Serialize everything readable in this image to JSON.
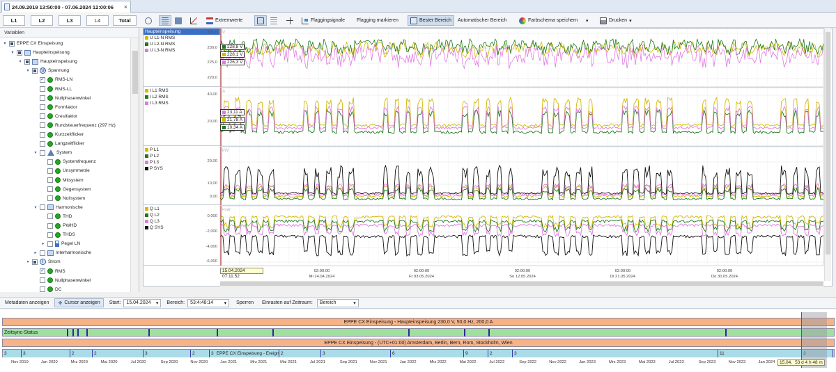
{
  "tab": {
    "title": "24.09.2019 13:50:00 - 07.06.2024 12:00:06"
  },
  "toolbar": {
    "buttons": [
      "L1",
      "L2",
      "L3",
      "L4",
      "Total"
    ],
    "extremwerte": "Extremwerte",
    "flaggingsignale": "Flaggingsignale",
    "flagging_markieren": "Flagging markieren",
    "bester_bereich": "Bester Bereich",
    "automatischer_bereich": "Automatischer Bereich",
    "farbschema": "Farbschema speichern",
    "drucken": "Drucken"
  },
  "tree": {
    "header": "Variablen",
    "items": [
      {
        "label": "EPPE CX Einspeisung",
        "level": 0,
        "arrow": "▾",
        "check": "part",
        "icon": "none"
      },
      {
        "label": "Haupteinspeisung",
        "level": 1,
        "arrow": "▾",
        "check": "part",
        "icon": "device"
      },
      {
        "label": "Haupteinspeisung",
        "level": 2,
        "arrow": "▾",
        "check": "part",
        "icon": "meter"
      },
      {
        "label": "Spannung",
        "level": 3,
        "arrow": "▾",
        "check": "part",
        "icon": "U"
      },
      {
        "label": "RMS-LN",
        "level": 4,
        "arrow": "",
        "check": "checked",
        "icon": "dot"
      },
      {
        "label": "RMS-LL",
        "level": 4,
        "arrow": "",
        "check": "empty",
        "icon": "dot"
      },
      {
        "label": "Nullphasenwinkel",
        "level": 4,
        "arrow": "",
        "check": "empty",
        "icon": "dot"
      },
      {
        "label": "Formfaktor",
        "level": 4,
        "arrow": "",
        "check": "empty",
        "icon": "dot"
      },
      {
        "label": "Crestfaktor",
        "level": 4,
        "arrow": "",
        "check": "empty",
        "icon": "dot"
      },
      {
        "label": "Rundsteuerfrequenz (297 Hz)",
        "level": 4,
        "arrow": "",
        "check": "empty",
        "icon": "dot"
      },
      {
        "label": "Kurzzeitflicker",
        "level": 4,
        "arrow": "",
        "check": "empty",
        "icon": "dot"
      },
      {
        "label": "Langzeitflicker",
        "level": 4,
        "arrow": "",
        "check": "empty",
        "icon": "dot"
      },
      {
        "label": "System",
        "level": 4,
        "arrow": "▾",
        "check": "empty",
        "icon": "triangle"
      },
      {
        "label": "Systemfrequenz",
        "level": 5,
        "arrow": "",
        "check": "empty",
        "icon": "dot"
      },
      {
        "label": "Unsymmetrie",
        "level": 5,
        "arrow": "",
        "check": "empty",
        "icon": "dot"
      },
      {
        "label": "Mitsystem",
        "level": 5,
        "arrow": "",
        "check": "empty",
        "icon": "dot"
      },
      {
        "label": "Gegensystem",
        "level": 5,
        "arrow": "",
        "check": "empty",
        "icon": "dot"
      },
      {
        "label": "Nullsystem",
        "level": 5,
        "arrow": "",
        "check": "empty",
        "icon": "dot"
      },
      {
        "label": "Harmonische",
        "level": 4,
        "arrow": "▾",
        "check": "empty",
        "icon": "chart"
      },
      {
        "label": "THD",
        "level": 5,
        "arrow": "",
        "check": "empty",
        "icon": "dot"
      },
      {
        "label": "PWHD",
        "level": 5,
        "arrow": "",
        "check": "empty",
        "icon": "dot"
      },
      {
        "label": "THDS",
        "level": 5,
        "arrow": "",
        "check": "empty",
        "icon": "dot"
      },
      {
        "label": "Pegel LN",
        "level": 5,
        "arrow": "▸",
        "check": "empty",
        "icon": "bar"
      },
      {
        "label": "Interharmonische",
        "level": 4,
        "arrow": "▸",
        "check": "empty",
        "icon": "chart"
      },
      {
        "label": "Strom",
        "level": 3,
        "arrow": "▾",
        "check": "part",
        "icon": "I"
      },
      {
        "label": "RMS",
        "level": 4,
        "arrow": "",
        "check": "checked",
        "icon": "dot"
      },
      {
        "label": "Nullphasenwinkel",
        "level": 4,
        "arrow": "",
        "check": "empty",
        "icon": "dot"
      },
      {
        "label": "DC",
        "level": 4,
        "arrow": "",
        "check": "empty",
        "icon": "dot"
      }
    ]
  },
  "charts": [
    {
      "legend": [
        {
          "label": "Haupteinspeisung",
          "color": "",
          "selected": true
        },
        {
          "label": "U L1-N RMS",
          "color": "#d4b800"
        },
        {
          "label": "U L2-N RMS",
          "color": "#1a7a1a"
        },
        {
          "label": "U L3-N RMS",
          "color": "#e07ae0"
        }
      ],
      "unit": "V",
      "ticks": [
        "235,0",
        "230,0",
        "225,0",
        "220,0"
      ],
      "values": [
        {
          "text": "228,8 V",
          "color": "#1a7a1a"
        },
        {
          "text": "228,1 V",
          "color": "#d4b800"
        },
        {
          "text": "226,3 V",
          "color": "#e07ae0"
        }
      ]
    },
    {
      "legend": [
        {
          "label": "I L1 RMS",
          "color": "#d4b800"
        },
        {
          "label": "I L2 RMS",
          "color": "#1a7a1a"
        },
        {
          "label": "I L3 RMS",
          "color": "#e07ae0"
        }
      ],
      "unit": "A",
      "ticks": [
        "40,00",
        "20,00"
      ],
      "values": [
        {
          "text": "23,11 A",
          "color": "#e07ae0"
        },
        {
          "text": "21,78 A",
          "color": "#d4b800"
        },
        {
          "text": "10,34 A",
          "color": "#1a7a1a"
        }
      ]
    },
    {
      "legend": [
        {
          "label": "P L1",
          "color": "#d4b800"
        },
        {
          "label": "P L2",
          "color": "#1a7a1a"
        },
        {
          "label": "P L3",
          "color": "#e07ae0"
        },
        {
          "label": "P SYS",
          "color": "#111111"
        }
      ],
      "unit": "kW",
      "ticks": [
        "20,00",
        "10,00",
        "0,00"
      ],
      "values": []
    },
    {
      "legend": [
        {
          "label": "Q L1",
          "color": "#d4b800"
        },
        {
          "label": "Q L2",
          "color": "#1a7a1a"
        },
        {
          "label": "Q L3",
          "color": "#e07ae0"
        },
        {
          "label": "Q SYS",
          "color": "#111111"
        }
      ],
      "unit": "kvar",
      "ticks": [
        "0,000",
        "-2,000",
        "-4,000",
        "-6,000"
      ],
      "values": []
    }
  ],
  "xaxis": {
    "cursor": "15.04.2024 07:11:52",
    "ticks": [
      {
        "time": "02:00:00",
        "date": "Mi 24.04.2024"
      },
      {
        "time": "02:00:00",
        "date": "Fr 03.05.2024"
      },
      {
        "time": "02:00:00",
        "date": "So 12.05.2024"
      },
      {
        "time": "02:00:00",
        "date": "Di 21.05.2024"
      },
      {
        "time": "02:00:00",
        "date": "Do 30.05.2024"
      }
    ]
  },
  "statusbar": {
    "metadaten": "Metadaten anzeigen",
    "cursor": "Cursor anzeigen",
    "start_label": "Start:",
    "start_value": "15.04.2024",
    "bereich_label": "Bereich:",
    "bereich_value": "53:4:48:14",
    "sperren": "Sperren",
    "einrasten_label": "Einrasten auf Zeitraum:",
    "einrasten_value": "Bereich"
  },
  "timeline": {
    "band1": "EPPE CX Einspeisung - Haupteinspeisung 230,0 V, 50,0 Hz, 200,0 A",
    "band2": "Zeitsync-Status",
    "band3": "EPPE CX Einspeisung -  (UTC+01:00) Amsterdam, Berlin, Bern, Rom, Stockholm, Wien",
    "band4_label": "EPPE CX Einspeisung - Ereignisse",
    "counts": [
      "3",
      "3",
      "2",
      "2",
      "3",
      "2",
      "3",
      "2",
      "3",
      "6",
      "9",
      "2",
      "3",
      "11",
      "3"
    ],
    "dates": [
      "Nov 2019",
      "Jan 2020",
      "Mrz 2020",
      "Mai 2020",
      "Jul 2020",
      "Sep 2020",
      "Nov 2020",
      "Jan 2021",
      "Mrz 2021",
      "Mai 2021",
      "Jul 2021",
      "Sep 2021",
      "Nov 2021",
      "Jan 2022",
      "Mrz 2022",
      "Mai 2022",
      "Jul 2022",
      "Sep 2022",
      "Nov 2022",
      "Jan 2023",
      "Mrz 2023",
      "Mai 2023",
      "Jul 2023",
      "Sep 2023",
      "Nov 2023",
      "Jan 2024",
      "Mrz 2024"
    ],
    "selection": "15.04.",
    "duration": "53 d 4 h 48 m"
  }
}
